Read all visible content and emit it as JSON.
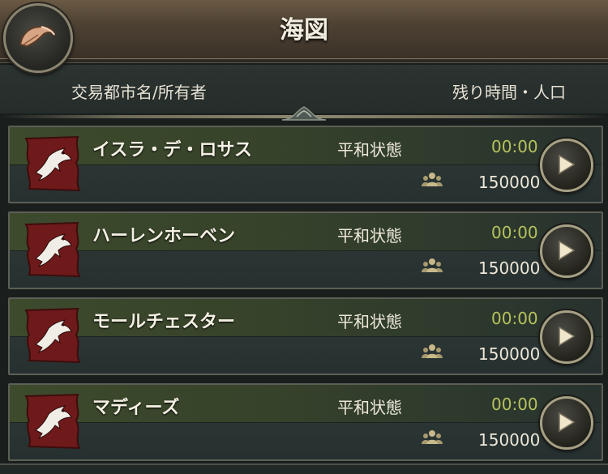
{
  "header": {
    "title": "海図",
    "back_icon": "scroll-back-icon"
  },
  "columns": {
    "left": "交易都市名/所有者",
    "right": "残り時間・人口"
  },
  "colors": {
    "time_text": "#b6c25c",
    "flag_red": "#6e1a1a"
  },
  "cities": [
    {
      "name": "イスラ・デ・ロサス",
      "status": "平和状態",
      "time": "00:00",
      "population": "150000"
    },
    {
      "name": "ハーレンホーベン",
      "status": "平和状態",
      "time": "00:00",
      "population": "150000"
    },
    {
      "name": "モールチェスター",
      "status": "平和状態",
      "time": "00:00",
      "population": "150000"
    },
    {
      "name": "マディーズ",
      "status": "平和状態",
      "time": "00:00",
      "population": "150000"
    }
  ]
}
